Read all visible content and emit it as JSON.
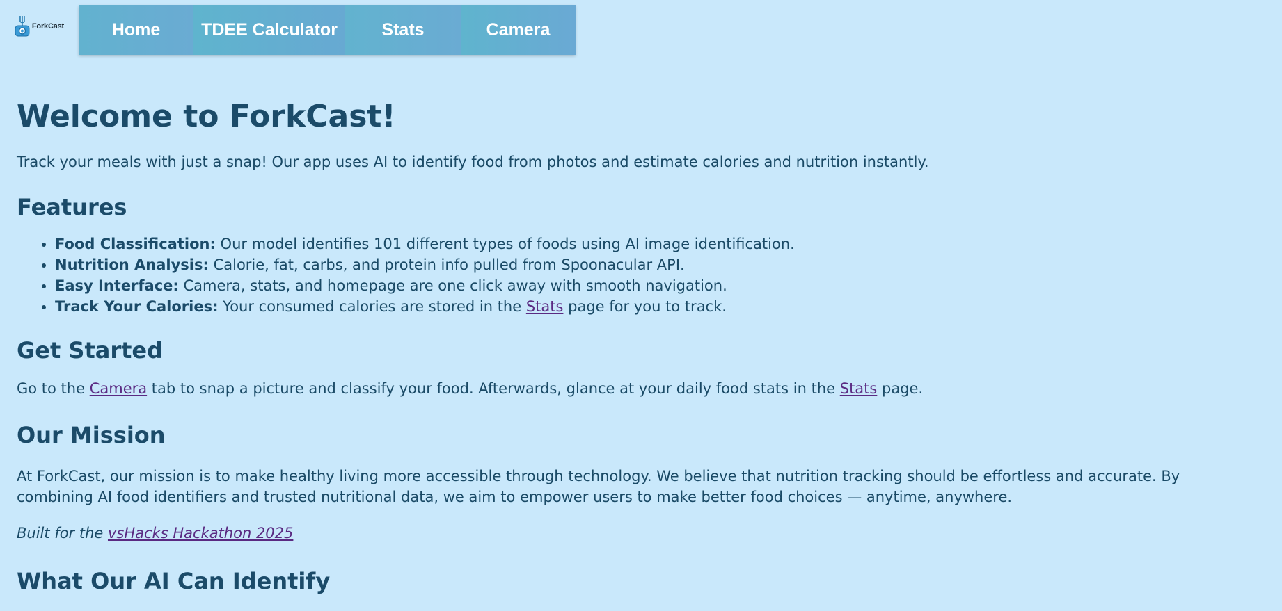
{
  "app": {
    "logo_text": "ForkCast"
  },
  "nav": {
    "home": "Home",
    "tdee": "TDEE Calculator",
    "stats": "Stats",
    "camera": "Camera"
  },
  "main": {
    "title": "Welcome to ForkCast!",
    "intro": "Track your meals with just a snap! Our app uses AI to identify food from photos and estimate calories and nutrition instantly.",
    "features_heading": "Features",
    "features": [
      {
        "label": "Food Classification:",
        "text": " Our model identifies 101 different types of foods using AI image identification."
      },
      {
        "label": "Nutrition Analysis:",
        "text": " Calorie, fat, carbs, and protein info pulled from Spoonacular API."
      },
      {
        "label": "Easy Interface:",
        "text": " Camera, stats, and homepage are one click away with smooth navigation."
      },
      {
        "label": "Track Your Calories:",
        "text_before": " Your consumed calories are stored in the ",
        "link": "Stats",
        "text_after": " page for you to track."
      }
    ],
    "get_started_heading": "Get Started",
    "get_started": {
      "part1": "Go to the ",
      "link1": "Camera",
      "part2": " tab to snap a picture and classify your food. Afterwards, glance at your daily food stats in the ",
      "link2": "Stats",
      "part3": " page."
    },
    "mission_heading": "Our Mission",
    "mission_text": "At ForkCast, our mission is to make healthy living more accessible through technology. We believe that nutrition tracking should be effortless and accurate. By combining AI food identifiers and trusted nutritional data, we aim to empower users to make better food choices — anytime, anywhere.",
    "built_prefix": "Built for the ",
    "built_link": "vsHacks Hackathon 2025",
    "identify_heading": "What Our AI Can Identify"
  },
  "colors": {
    "background": "#c9e8fb",
    "nav": "#64afd1",
    "text": "#1a4a66",
    "link": "#5a2a82"
  }
}
